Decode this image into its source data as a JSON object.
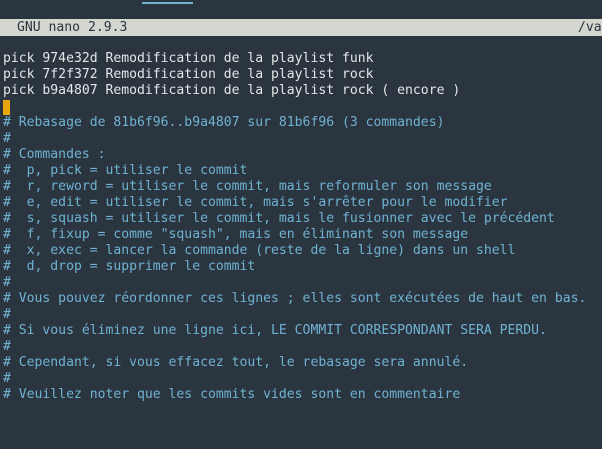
{
  "titlebar": {
    "app": "GNU nano 2.9.3",
    "path_fragment": "/va"
  },
  "colors": {
    "background": "#2b3540",
    "titlebar_bg": "#d3d7cf",
    "comment": "#6fb3d2",
    "text": "#e6e6e6",
    "cursor": "#e9a60a"
  },
  "editor": {
    "pick_lines": [
      "pick 974e32d Remodification de la playlist funk",
      "pick 7f2f372 Remodification de la playlist rock",
      "pick b9a4807 Remodification de la playlist rock ( encore )"
    ],
    "comment_lines": [
      "# Rebasage de 81b6f96..b9a4807 sur 81b6f96 (3 commandes)",
      "#",
      "# Commandes :",
      "#  p, pick = utiliser le commit",
      "#  r, reword = utiliser le commit, mais reformuler son message",
      "#  e, edit = utiliser le commit, mais s'arrêter pour le modifier",
      "#  s, squash = utiliser le commit, mais le fusionner avec le précédent",
      "#  f, fixup = comme \"squash\", mais en éliminant son message",
      "#  x, exec = lancer la commande (reste de la ligne) dans un shell",
      "#  d, drop = supprimer le commit",
      "#",
      "# Vous pouvez réordonner ces lignes ; elles sont exécutées de haut en bas.",
      "#",
      "# Si vous éliminez une ligne ici, LE COMMIT CORRESPONDANT SERA PERDU.",
      "#",
      "# Cependant, si vous effacez tout, le rebasage sera annulé.",
      "#",
      "# Veuillez noter que les commits vides sont en commentaire"
    ]
  }
}
